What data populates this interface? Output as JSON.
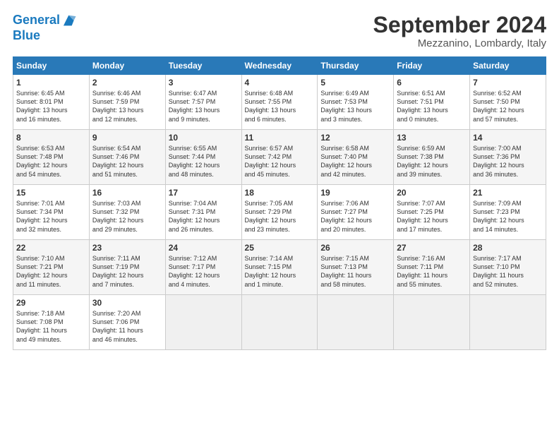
{
  "logo": {
    "line1": "General",
    "line2": "Blue"
  },
  "title": "September 2024",
  "location": "Mezzanino, Lombardy, Italy",
  "days_header": [
    "Sunday",
    "Monday",
    "Tuesday",
    "Wednesday",
    "Thursday",
    "Friday",
    "Saturday"
  ],
  "weeks": [
    [
      {
        "num": "1",
        "info": "Sunrise: 6:45 AM\nSunset: 8:01 PM\nDaylight: 13 hours\nand 16 minutes."
      },
      {
        "num": "2",
        "info": "Sunrise: 6:46 AM\nSunset: 7:59 PM\nDaylight: 13 hours\nand 12 minutes."
      },
      {
        "num": "3",
        "info": "Sunrise: 6:47 AM\nSunset: 7:57 PM\nDaylight: 13 hours\nand 9 minutes."
      },
      {
        "num": "4",
        "info": "Sunrise: 6:48 AM\nSunset: 7:55 PM\nDaylight: 13 hours\nand 6 minutes."
      },
      {
        "num": "5",
        "info": "Sunrise: 6:49 AM\nSunset: 7:53 PM\nDaylight: 13 hours\nand 3 minutes."
      },
      {
        "num": "6",
        "info": "Sunrise: 6:51 AM\nSunset: 7:51 PM\nDaylight: 13 hours\nand 0 minutes."
      },
      {
        "num": "7",
        "info": "Sunrise: 6:52 AM\nSunset: 7:50 PM\nDaylight: 12 hours\nand 57 minutes."
      }
    ],
    [
      {
        "num": "8",
        "info": "Sunrise: 6:53 AM\nSunset: 7:48 PM\nDaylight: 12 hours\nand 54 minutes."
      },
      {
        "num": "9",
        "info": "Sunrise: 6:54 AM\nSunset: 7:46 PM\nDaylight: 12 hours\nand 51 minutes."
      },
      {
        "num": "10",
        "info": "Sunrise: 6:55 AM\nSunset: 7:44 PM\nDaylight: 12 hours\nand 48 minutes."
      },
      {
        "num": "11",
        "info": "Sunrise: 6:57 AM\nSunset: 7:42 PM\nDaylight: 12 hours\nand 45 minutes."
      },
      {
        "num": "12",
        "info": "Sunrise: 6:58 AM\nSunset: 7:40 PM\nDaylight: 12 hours\nand 42 minutes."
      },
      {
        "num": "13",
        "info": "Sunrise: 6:59 AM\nSunset: 7:38 PM\nDaylight: 12 hours\nand 39 minutes."
      },
      {
        "num": "14",
        "info": "Sunrise: 7:00 AM\nSunset: 7:36 PM\nDaylight: 12 hours\nand 36 minutes."
      }
    ],
    [
      {
        "num": "15",
        "info": "Sunrise: 7:01 AM\nSunset: 7:34 PM\nDaylight: 12 hours\nand 32 minutes."
      },
      {
        "num": "16",
        "info": "Sunrise: 7:03 AM\nSunset: 7:32 PM\nDaylight: 12 hours\nand 29 minutes."
      },
      {
        "num": "17",
        "info": "Sunrise: 7:04 AM\nSunset: 7:31 PM\nDaylight: 12 hours\nand 26 minutes."
      },
      {
        "num": "18",
        "info": "Sunrise: 7:05 AM\nSunset: 7:29 PM\nDaylight: 12 hours\nand 23 minutes."
      },
      {
        "num": "19",
        "info": "Sunrise: 7:06 AM\nSunset: 7:27 PM\nDaylight: 12 hours\nand 20 minutes."
      },
      {
        "num": "20",
        "info": "Sunrise: 7:07 AM\nSunset: 7:25 PM\nDaylight: 12 hours\nand 17 minutes."
      },
      {
        "num": "21",
        "info": "Sunrise: 7:09 AM\nSunset: 7:23 PM\nDaylight: 12 hours\nand 14 minutes."
      }
    ],
    [
      {
        "num": "22",
        "info": "Sunrise: 7:10 AM\nSunset: 7:21 PM\nDaylight: 12 hours\nand 11 minutes."
      },
      {
        "num": "23",
        "info": "Sunrise: 7:11 AM\nSunset: 7:19 PM\nDaylight: 12 hours\nand 7 minutes."
      },
      {
        "num": "24",
        "info": "Sunrise: 7:12 AM\nSunset: 7:17 PM\nDaylight: 12 hours\nand 4 minutes."
      },
      {
        "num": "25",
        "info": "Sunrise: 7:14 AM\nSunset: 7:15 PM\nDaylight: 12 hours\nand 1 minute."
      },
      {
        "num": "26",
        "info": "Sunrise: 7:15 AM\nSunset: 7:13 PM\nDaylight: 11 hours\nand 58 minutes."
      },
      {
        "num": "27",
        "info": "Sunrise: 7:16 AM\nSunset: 7:11 PM\nDaylight: 11 hours\nand 55 minutes."
      },
      {
        "num": "28",
        "info": "Sunrise: 7:17 AM\nSunset: 7:10 PM\nDaylight: 11 hours\nand 52 minutes."
      }
    ],
    [
      {
        "num": "29",
        "info": "Sunrise: 7:18 AM\nSunset: 7:08 PM\nDaylight: 11 hours\nand 49 minutes."
      },
      {
        "num": "30",
        "info": "Sunrise: 7:20 AM\nSunset: 7:06 PM\nDaylight: 11 hours\nand 46 minutes."
      },
      {
        "num": "",
        "info": ""
      },
      {
        "num": "",
        "info": ""
      },
      {
        "num": "",
        "info": ""
      },
      {
        "num": "",
        "info": ""
      },
      {
        "num": "",
        "info": ""
      }
    ]
  ]
}
